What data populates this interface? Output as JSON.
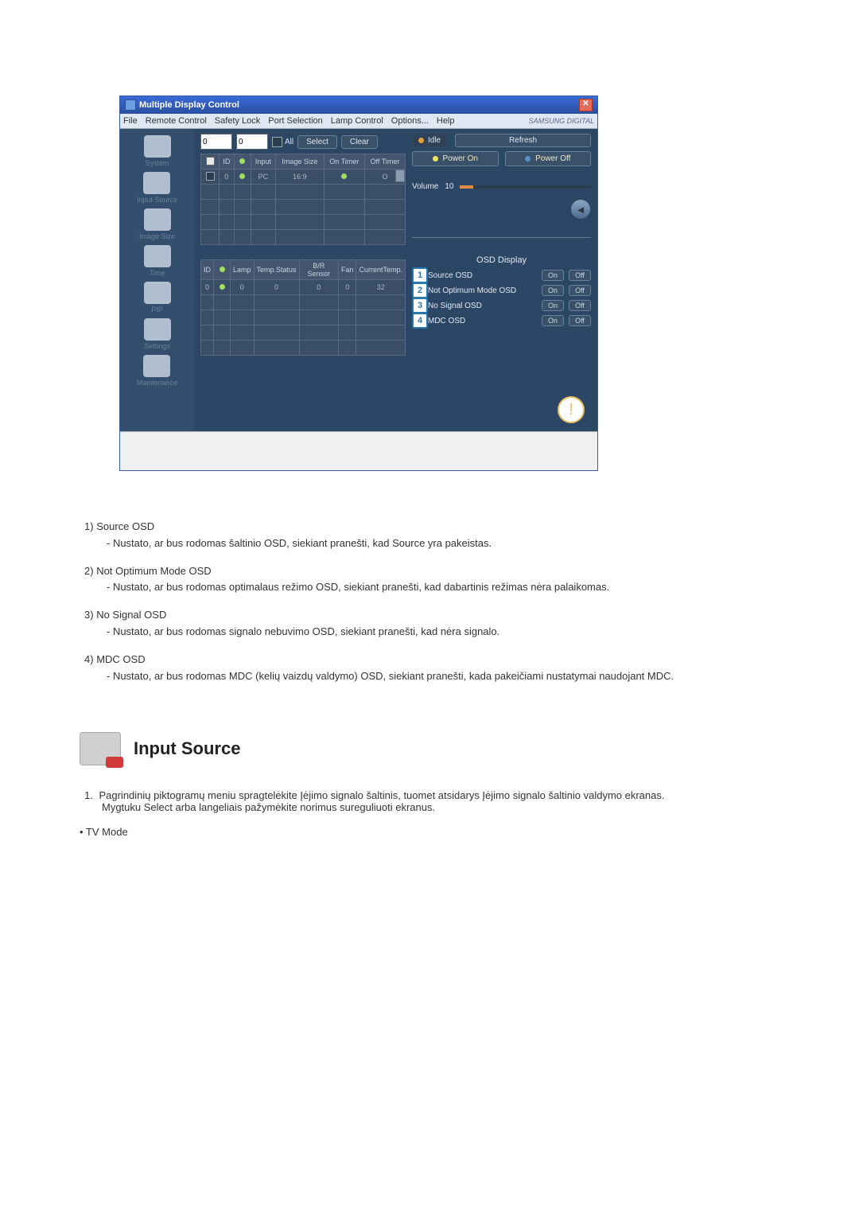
{
  "window": {
    "title": "Multiple Display Control",
    "brand": "SAMSUNG DIGITAL"
  },
  "menu": [
    "File",
    "Remote Control",
    "Safety Lock",
    "Port Selection",
    "Lamp Control",
    "Options...",
    "Help"
  ],
  "sidebar": [
    {
      "label": "System"
    },
    {
      "label": "Input Source"
    },
    {
      "label": "Image Size"
    },
    {
      "label": "Time"
    },
    {
      "label": "PIP"
    },
    {
      "label": "Settings"
    },
    {
      "label": "Maintenance"
    }
  ],
  "toolbar": {
    "sel1": "0",
    "sel2": "0",
    "all": "All",
    "select": "Select",
    "clear": "Clear",
    "idle": "Idle",
    "refresh": "Refresh"
  },
  "grid1": {
    "headers": [
      "",
      "ID",
      "",
      "Input",
      "Image Size",
      "On Timer",
      "Off Timer"
    ],
    "row": [
      "",
      "0",
      "",
      "PC",
      "16:9",
      "",
      ""
    ]
  },
  "power": {
    "on": "Power On",
    "off": "Power Off"
  },
  "volume": {
    "label": "Volume",
    "value": "10"
  },
  "grid2": {
    "headers": [
      "ID",
      "",
      "Lamp",
      "Temp.Status",
      "B/R Sensor",
      "Fan",
      "CurrentTemp."
    ],
    "row": [
      "0",
      "",
      "0",
      "0",
      "0",
      "0",
      "32"
    ]
  },
  "osd": {
    "title": "OSD Display",
    "rows": [
      {
        "n": "1",
        "label": "Source OSD"
      },
      {
        "n": "2",
        "label": "Not Optimum Mode OSD"
      },
      {
        "n": "3",
        "label": "No Signal OSD"
      },
      {
        "n": "4",
        "label": "MDC OSD"
      }
    ],
    "on": "On",
    "off": "Off"
  },
  "doc": {
    "items": [
      {
        "n": "1)",
        "title": "Source OSD",
        "desc": "- Nustato, ar bus rodomas šaltinio OSD, siekiant pranešti, kad Source yra pakeistas."
      },
      {
        "n": "2)",
        "title": "Not Optimum Mode OSD",
        "desc": "- Nustato, ar bus rodomas optimalaus režimo OSD, siekiant pranešti, kad dabartinis režimas nėra palaikomas."
      },
      {
        "n": "3)",
        "title": "No Signal OSD",
        "desc": "- Nustato, ar bus rodomas signalo nebuvimo OSD, siekiant pranešti, kad nėra signalo."
      },
      {
        "n": "4)",
        "title": "MDC OSD",
        "desc": "- Nustato, ar bus rodomas MDC (kelių vaizdų valdymo) OSD, siekiant pranešti, kada pakeičiami nustatymai naudojant MDC."
      }
    ],
    "heading": "Input Source",
    "numlist": [
      {
        "n": "1.",
        "body": "Pagrindinių piktogramų meniu spragtelėkite Įėjimo signalo šaltinis, tuomet atsidarys Įėjimo signalo šaltinio valdymo ekranas.",
        "body2": "Mygtuku Select arba langeliais pažymėkite norimus sureguliuoti ekranus."
      }
    ],
    "bullet": "• TV Mode"
  }
}
